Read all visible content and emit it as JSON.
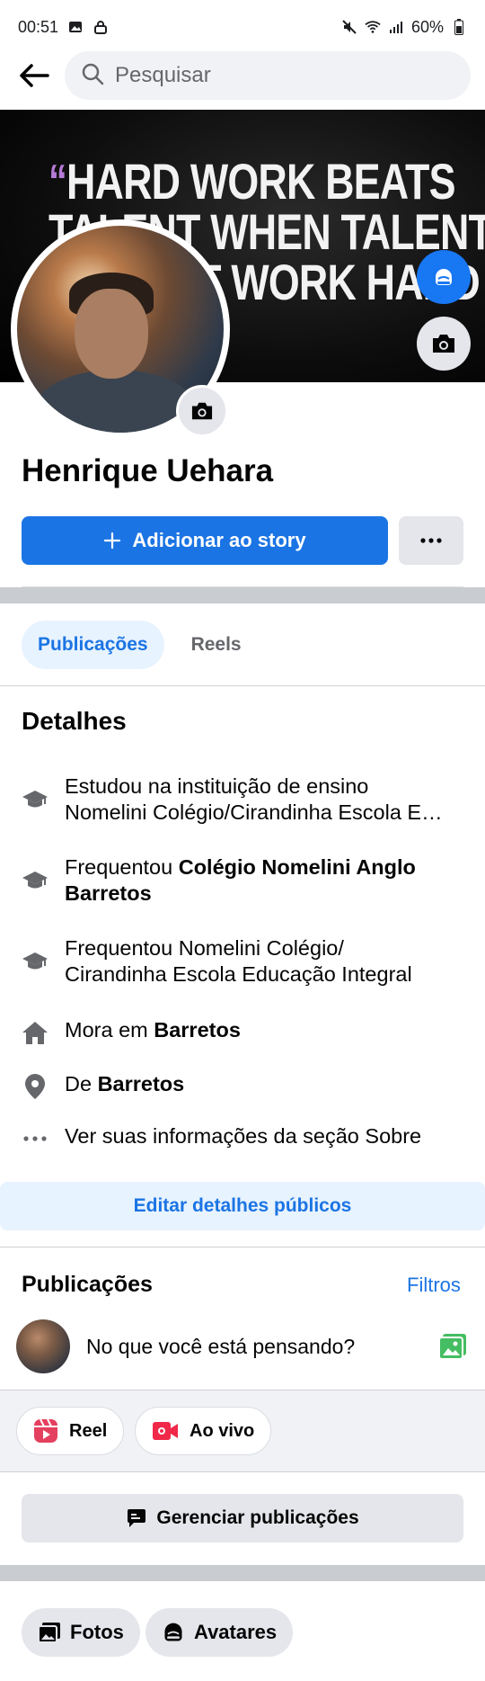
{
  "status_bar": {
    "time": "00:51",
    "battery": "60%",
    "icons": [
      "image-icon",
      "lock-icon",
      "mute-icon",
      "wifi-icon",
      "signal-icon",
      "battery-icon"
    ]
  },
  "search": {
    "placeholder": "Pesquisar"
  },
  "cover": {
    "quote_lines": [
      "HARD WORK BEATS",
      "TALENT WHEN TALENT",
      "DOESN'T WORK HARD"
    ],
    "quote_mark": "“"
  },
  "profile": {
    "name": "Henrique Uehara",
    "add_story_label": "Adicionar ao story",
    "more_label": "•••"
  },
  "tabs": [
    {
      "label": "Publicações",
      "active": true
    },
    {
      "label": "Reels",
      "active": false
    }
  ],
  "details": {
    "title": "Detalhes",
    "items": [
      {
        "icon": "graduation-cap-icon",
        "prefix": "Estudou na instituição de ensino",
        "line2": "Nomelini Colégio/Cirandinha Escola Educação Integral"
      },
      {
        "icon": "graduation-cap-icon",
        "prefix": "Frequentou ",
        "bold": "Colégio Nomelini Anglo",
        "bold2": "Barretos"
      },
      {
        "icon": "graduation-cap-icon",
        "prefix": "Frequentou Nomelini Colégio/",
        "line2": "Cirandinha Escola Educação Integral"
      },
      {
        "icon": "home-icon",
        "prefix": "Mora em ",
        "bold": "Barretos"
      },
      {
        "icon": "location-pin-icon",
        "prefix": "De ",
        "bold": "Barretos"
      },
      {
        "icon": "more-dots-icon",
        "prefix": "Ver suas informações da seção Sobre"
      }
    ],
    "edit_label": "Editar detalhes públicos"
  },
  "posts": {
    "title": "Publicações",
    "filters_label": "Filtros",
    "composer_placeholder": "No que você está pensando?",
    "reel_label": "Reel",
    "live_label": "Ao vivo",
    "manage_label": "Gerenciar publicações"
  },
  "media": {
    "photos_label": "Fotos",
    "avatars_label": "Avatares"
  },
  "colors": {
    "accent": "#1b74e4",
    "accent_light": "#e7f3ff",
    "reel": "#e4405f",
    "live": "#f02849",
    "photo": "#45bd62"
  }
}
